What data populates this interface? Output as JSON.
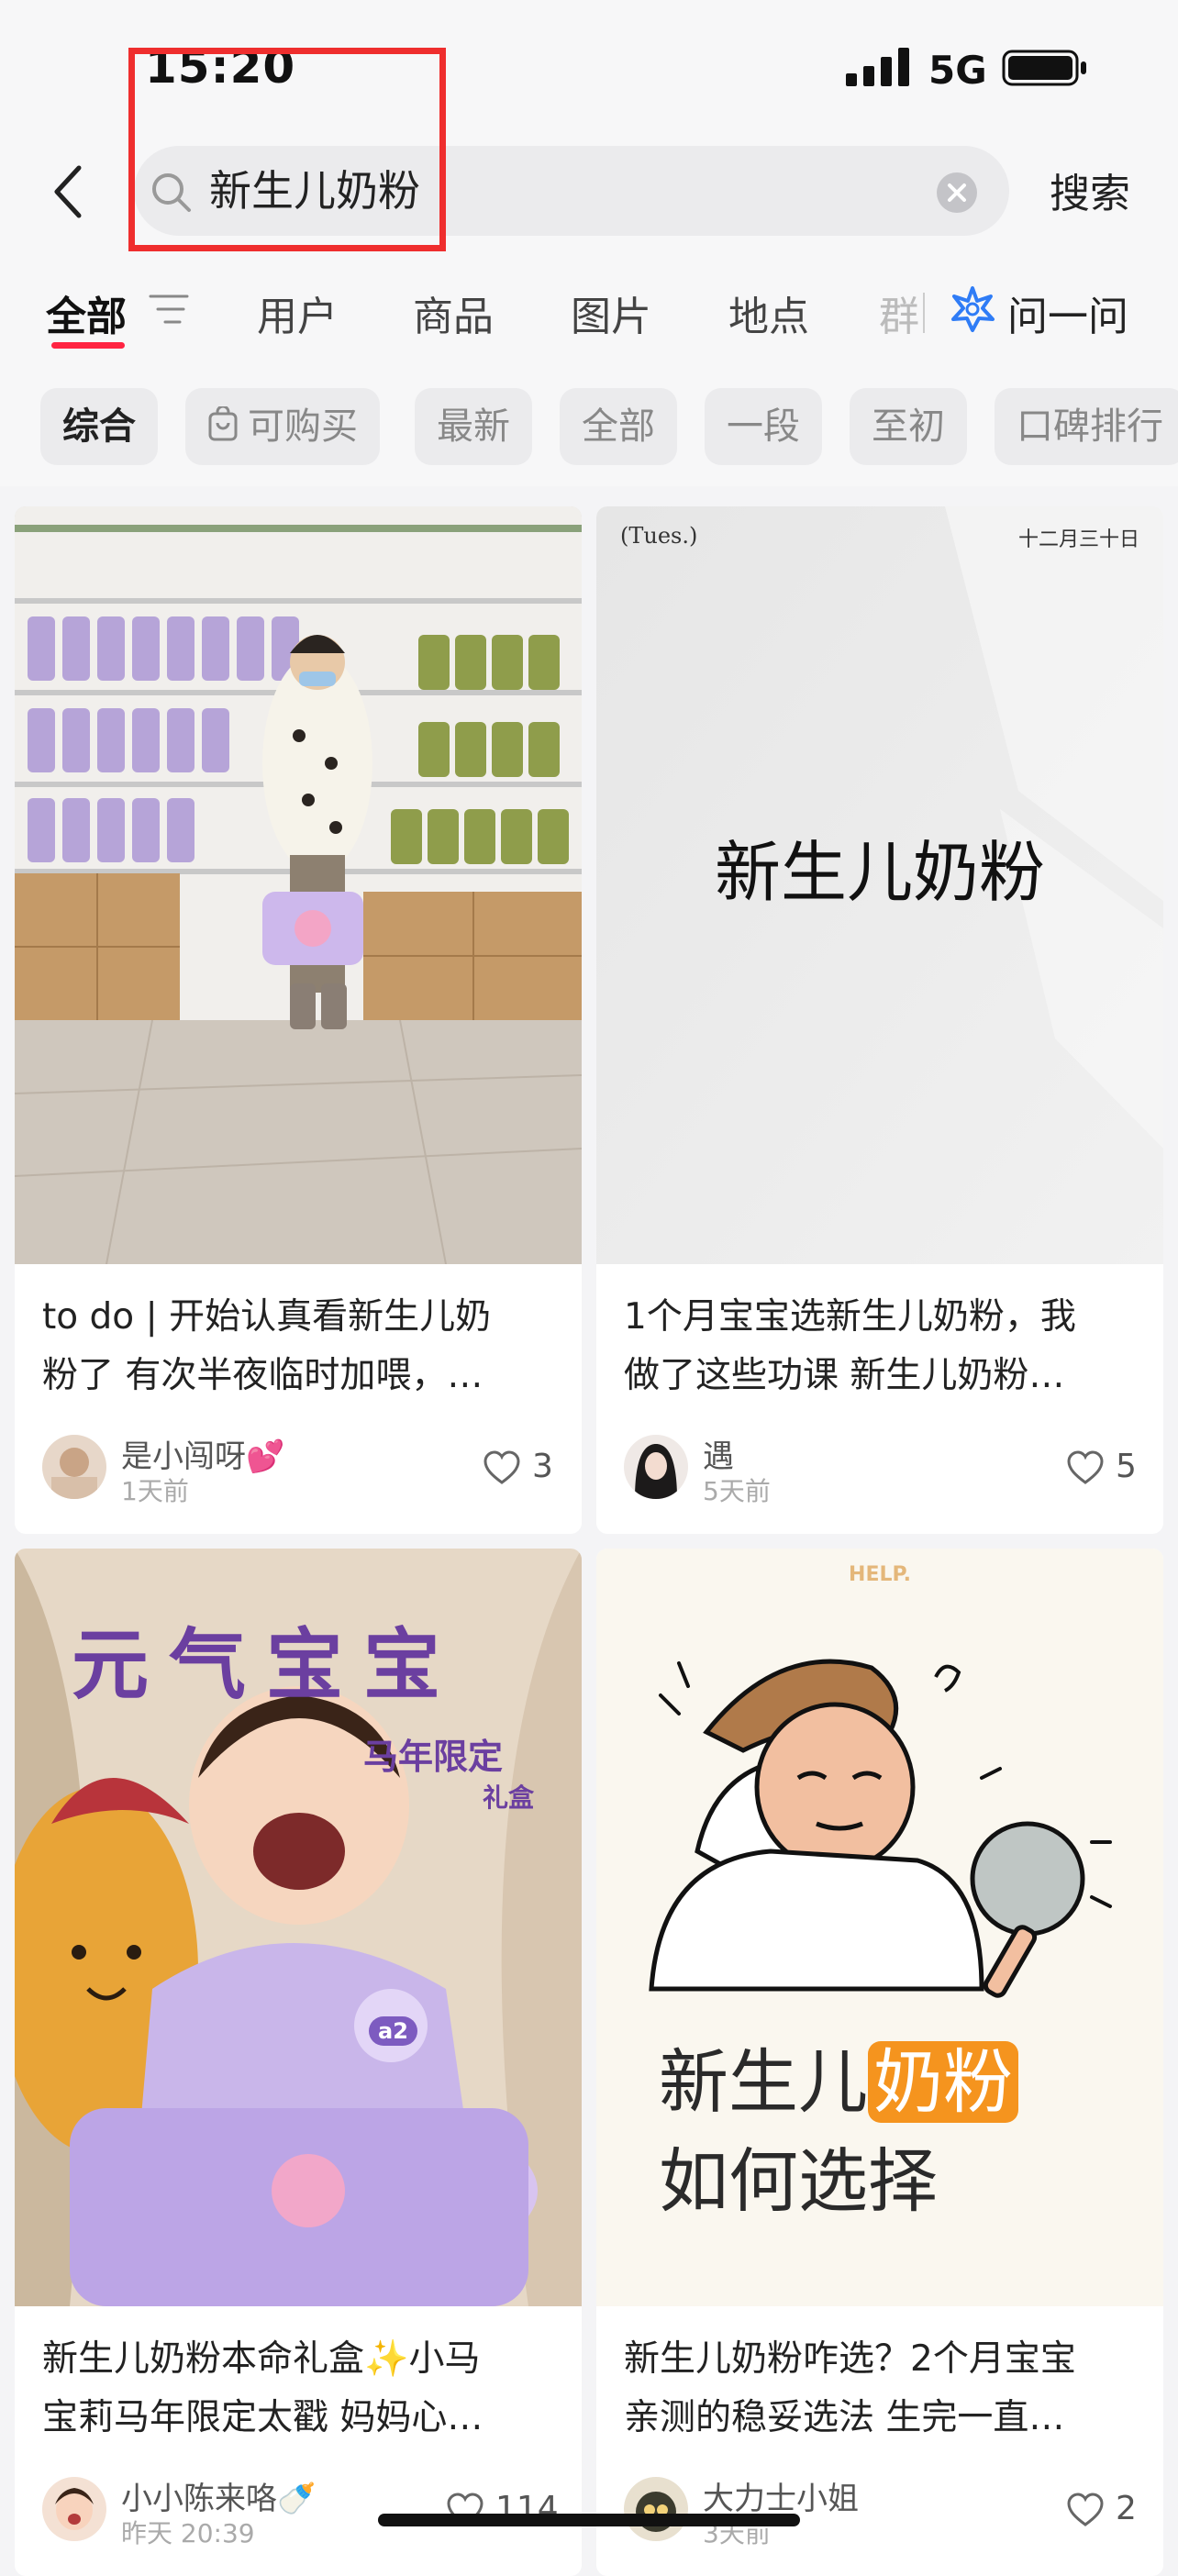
{
  "status_bar": {
    "time": "15:20",
    "network": "5G"
  },
  "search": {
    "query": "新生儿奶粉",
    "submit_label": "搜索"
  },
  "tabs": [
    "全部",
    "用户",
    "商品",
    "图片",
    "地点",
    "群"
  ],
  "ask": {
    "label": "问一问"
  },
  "filters": [
    "综合",
    "可购买",
    "最新",
    "全部",
    "一段",
    "至初",
    "口碑排行"
  ],
  "cards": [
    {
      "title_line1": "to do | 开始认真看新生儿奶",
      "title_line2": "粉了 有次半夜临时加喂，…",
      "author": "是小闯呀💕",
      "date": "1天前",
      "likes": "3"
    },
    {
      "image_top_left": "(Tues.)",
      "image_top_right": "十二月三十日",
      "image_center": "新生儿奶粉",
      "title_line1": "1个月宝宝选新生儿奶粉，我",
      "title_line2": "做了这些功课 新生儿奶粉…",
      "author": "遇",
      "date": "5天前",
      "likes": "5"
    },
    {
      "image_headline": "元气宝宝",
      "image_sub1": "马年限定",
      "image_sub2": "礼盒",
      "image_badge": "a2",
      "title_line1": "新生儿奶粉本命礼盒✨小马",
      "title_line2": "宝莉马年限定太戳 妈妈心…",
      "author": "小小陈来咯🍼",
      "date": "昨天 20:39",
      "likes": "114"
    },
    {
      "image_top": "HELP.",
      "image_line1_a": "新生儿",
      "image_line1_b": "奶粉",
      "image_line2": "如何选择",
      "title_line1": "新生儿奶粉咋选？2个月宝宝",
      "title_line2": "亲测的稳妥选法 生完一直…",
      "author": "大力士小姐",
      "date": "3天前",
      "likes": "2"
    }
  ],
  "colors": {
    "accent": "#ff2442",
    "highlight_box": "#ef2e2e",
    "ask_icon": "#2f7cf6"
  },
  "icons": [
    "back-arrow-icon",
    "search-icon",
    "clear-icon",
    "filter-icon",
    "ask-sparkle-icon",
    "bag-icon",
    "heart-icon"
  ]
}
